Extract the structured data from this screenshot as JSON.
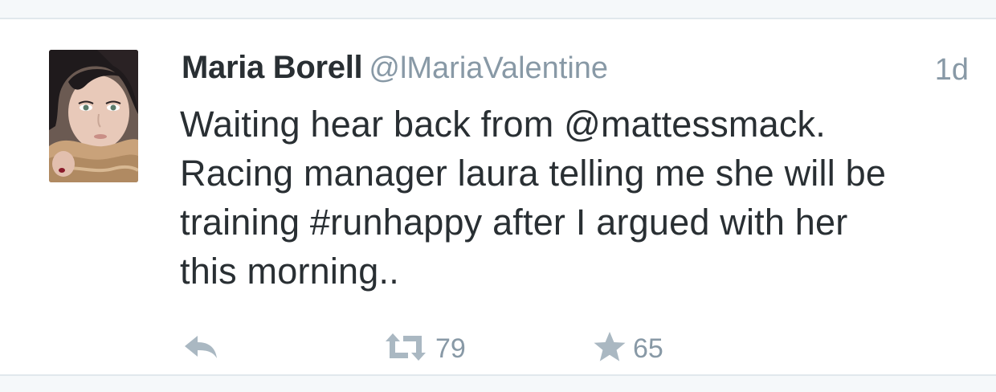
{
  "tweet": {
    "author": {
      "display_name": "Maria Borell",
      "handle": "@lMariaValentine",
      "avatar": "profile-photo"
    },
    "timestamp": "1d",
    "text": "Waiting hear back from @mattessmack.\nRacing manager laura telling me she will be\ntraining #runhappy after I argued with her\nthis morning..",
    "actions": {
      "reply": {
        "icon": "reply-icon"
      },
      "retweet": {
        "icon": "retweet-icon",
        "count": "79"
      },
      "favorite": {
        "icon": "star-icon",
        "count": "65"
      }
    }
  },
  "colors": {
    "text_primary": "#292f33",
    "text_secondary": "#8899a6",
    "icon_gray": "#aab8c2",
    "divider": "#e1e8ed",
    "background_band": "#f5f8fa"
  }
}
